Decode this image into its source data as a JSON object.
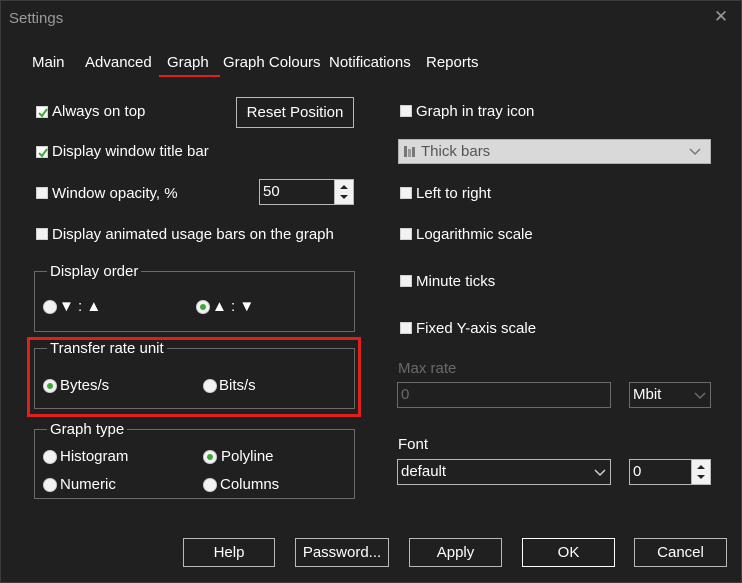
{
  "window": {
    "title": "Settings"
  },
  "tabs": [
    {
      "label": "Main"
    },
    {
      "label": "Advanced"
    },
    {
      "label": "Graph"
    },
    {
      "label": "Graph Colours"
    },
    {
      "label": "Notifications"
    },
    {
      "label": "Reports"
    }
  ],
  "active_tab": "Graph",
  "left": {
    "always_on_top": {
      "label": "Always on top",
      "checked": true
    },
    "reset_position": {
      "label": "Reset Position"
    },
    "display_title_bar": {
      "label": "Display window title bar",
      "checked": true
    },
    "window_opacity": {
      "label": "Window opacity, %",
      "checked": false,
      "value": "50"
    },
    "animated_bars": {
      "label": "Display animated usage bars on the graph",
      "checked": false
    },
    "display_order": {
      "legend": "Display order",
      "options": [
        {
          "label": "▼ : ▲",
          "selected": false
        },
        {
          "label": "▲ : ▼",
          "selected": true
        }
      ]
    },
    "transfer_rate_unit": {
      "legend": "Transfer rate unit",
      "options": [
        {
          "label": "Bytes/s",
          "selected": true
        },
        {
          "label": "Bits/s",
          "selected": false
        }
      ]
    },
    "graph_type": {
      "legend": "Graph type",
      "options": [
        {
          "label": "Histogram",
          "selected": false
        },
        {
          "label": "Polyline",
          "selected": true
        },
        {
          "label": "Numeric",
          "selected": false
        },
        {
          "label": "Columns",
          "selected": false
        }
      ]
    }
  },
  "right": {
    "graph_in_tray": {
      "label": "Graph in tray icon",
      "checked": false
    },
    "tray_style": {
      "value": "Thick bars"
    },
    "left_to_right": {
      "label": "Left to right",
      "checked": false
    },
    "log_scale": {
      "label": "Logarithmic scale",
      "checked": false
    },
    "minute_ticks": {
      "label": "Minute ticks",
      "checked": false
    },
    "fixed_y_axis": {
      "label": "Fixed Y-axis scale",
      "checked": false
    },
    "max_rate": {
      "label": "Max rate",
      "value": "0",
      "unit": "Mbit"
    },
    "font": {
      "label": "Font",
      "value": "default",
      "size": "0"
    }
  },
  "buttons": {
    "help": "Help",
    "password": "Password...",
    "apply": "Apply",
    "ok": "OK",
    "cancel": "Cancel"
  },
  "colors": {
    "background": "#202020",
    "accent": "#e0211b",
    "radio_selected": "#3aa83a",
    "checkmark": "#3aa83a"
  }
}
